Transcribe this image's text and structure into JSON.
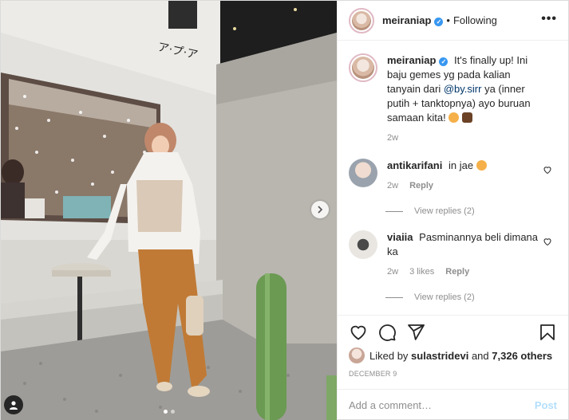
{
  "post": {
    "username": "meiraniap",
    "follow_separator": "•",
    "follow_status": "Following",
    "more_glyph": "•••"
  },
  "caption": {
    "username": "meiraniap",
    "text_before": "It's finally up! Ini baju gemes yg pada kalian tanyain dari",
    "mention": "@by.sirr",
    "text_after": "ya (inner putih + tanktopnya) ayo buruan samaan kita!",
    "time": "2w"
  },
  "comments": [
    {
      "username": "antikarifani",
      "text": "in jae",
      "time": "2w",
      "reply_label": "Reply",
      "view_replies": "View replies (2)"
    },
    {
      "username": "viaiia",
      "text": "Pasminannya beli dimana ka",
      "time": "2w",
      "likes": "3 likes",
      "reply_label": "Reply",
      "view_replies": "View replies (2)"
    }
  ],
  "likes": {
    "prefix": "Liked by",
    "user": "sulastridevi",
    "connector": "and",
    "others": "7,326 others"
  },
  "date": "DECEMBER 9",
  "add_comment": {
    "placeholder": "Add a comment…",
    "post_label": "Post"
  },
  "icons": {
    "like": "heart-icon",
    "comment": "comment-icon",
    "share": "paper-plane-icon",
    "save": "bookmark-icon",
    "next": "chevron-right-icon",
    "tags": "user-tag-icon"
  },
  "colors": {
    "verified": "#3897f0",
    "mention": "#00376b",
    "muted": "#8e8e8e",
    "post_disabled": "#b2dffc"
  },
  "carousel": {
    "total": 2,
    "active": 1
  }
}
